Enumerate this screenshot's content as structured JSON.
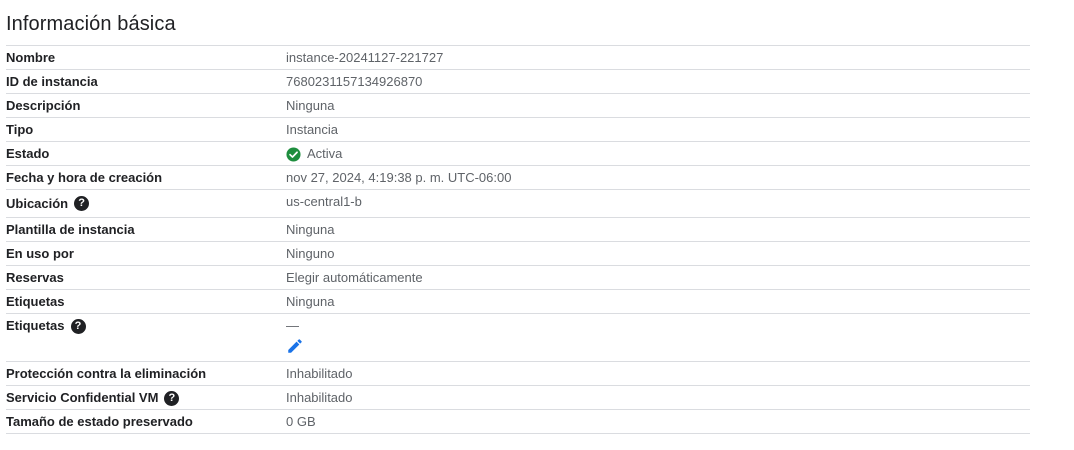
{
  "section": {
    "title": "Información básica"
  },
  "rows": [
    {
      "label": "Nombre",
      "value": "instance-20241127-221727"
    },
    {
      "label": "ID de instancia",
      "value": "7680231157134926870"
    },
    {
      "label": "Descripción",
      "value": "Ninguna"
    },
    {
      "label": "Tipo",
      "value": "Instancia"
    },
    {
      "label": "Estado",
      "value": "Activa",
      "status_icon": "check-circle-icon",
      "status_color": "#1e8e3e"
    },
    {
      "label": "Fecha y hora de creación",
      "value": "nov 27, 2024, 4:19:38 p. m. UTC-06:00"
    },
    {
      "label": "Ubicación",
      "value": "us-central1-b",
      "help_icon": "help-icon"
    },
    {
      "label": "Plantilla de instancia",
      "value": "Ninguna"
    },
    {
      "label": "En uso por",
      "value": "Ninguno"
    },
    {
      "label": "Reservas",
      "value": "Elegir automáticamente"
    },
    {
      "label": "Etiquetas",
      "value": "Ninguna"
    },
    {
      "label": "Etiquetas",
      "value": "—",
      "help_icon": "help-icon",
      "edit_icon": "edit-pencil-icon",
      "edit_color": "#1a73e8"
    },
    {
      "label": "Protección contra la eliminación",
      "value": "Inhabilitado"
    },
    {
      "label": "Servicio Confidential VM",
      "value": "Inhabilitado",
      "help_icon": "help-icon"
    },
    {
      "label": "Tamaño de estado preservado",
      "value": "0 GB"
    }
  ],
  "icons": {
    "help_glyph": "?"
  }
}
